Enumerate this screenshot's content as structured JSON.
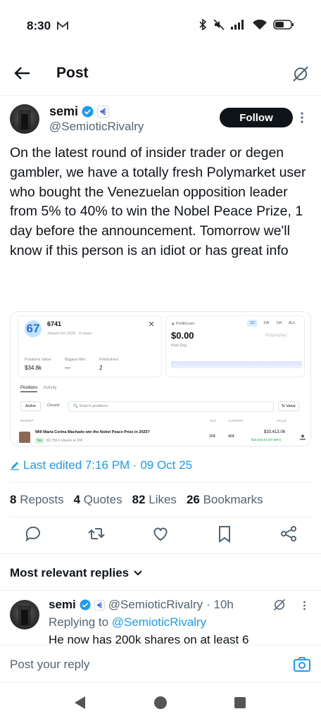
{
  "status_bar": {
    "time": "8:30"
  },
  "header": {
    "title": "Post"
  },
  "author": {
    "name": "semi",
    "handle": "@SemioticRivalry",
    "follow_label": "Follow"
  },
  "tweet": {
    "text": "On the latest round of insider trader or degen gambler, we have a totally fresh Polymarket user who bought the Venezuelan opposition leader from 5% to 40% to win the Nobel Peace Prize, 1 day before the announcement. Tomorrow we'll know if this person is an idiot or has great info",
    "edited": "Last edited 7:16 PM · 09 Oct 25"
  },
  "media": {
    "user_id": "6741",
    "joined": "Joined Oct 2025 · 0 views",
    "avatar_text": "67",
    "profit_loss_label": "Profit/Loss",
    "profit_value": "$0.00",
    "past_day": "Past Day",
    "ranges": [
      "1D",
      "1W",
      "1M",
      "ALL"
    ],
    "brand": "Polymarket",
    "positions_value_label": "Positions Value",
    "positions_value": "$34.8k",
    "biggest_win_label": "Biggest Win",
    "biggest_win": "—",
    "predictions_label": "Predictions",
    "predictions": "2",
    "tabs": [
      "Positions",
      "Activity"
    ],
    "filters": [
      "Active",
      "Closed"
    ],
    "search_placeholder": "Search positions",
    "sort_label": "Value",
    "columns": {
      "market": "MARKET",
      "avg": "AVG",
      "current": "CURRENT",
      "value": "VALUE"
    },
    "row": {
      "title": "Will Maria Corina Machado win the Nobel Peace Prize in 2025?",
      "badge": "Yes",
      "shares": "82,755.6 shares at 20¢",
      "avg": "20¢",
      "current": "40¢",
      "value": "$33,413.06",
      "change": "$16,533.51 (97.65%)"
    }
  },
  "stats": {
    "reposts_count": "8",
    "reposts_label": "Reposts",
    "quotes_count": "4",
    "quotes_label": "Quotes",
    "likes_count": "82",
    "likes_label": "Likes",
    "bookmarks_count": "26",
    "bookmarks_label": "Bookmarks"
  },
  "replies": {
    "header": "Most relevant replies",
    "first": {
      "name": "semi",
      "handle": "@SemioticRivalry",
      "time": "· 10h",
      "replying_prefix": "Replying to",
      "replying_to": "@SemioticRivalry",
      "text": "He now has 200k shares on at least 6"
    }
  },
  "reply_box": {
    "placeholder": "Post your reply"
  },
  "colors": {
    "accent": "#1d9bf0",
    "text": "#0f1419",
    "muted": "#536471"
  }
}
